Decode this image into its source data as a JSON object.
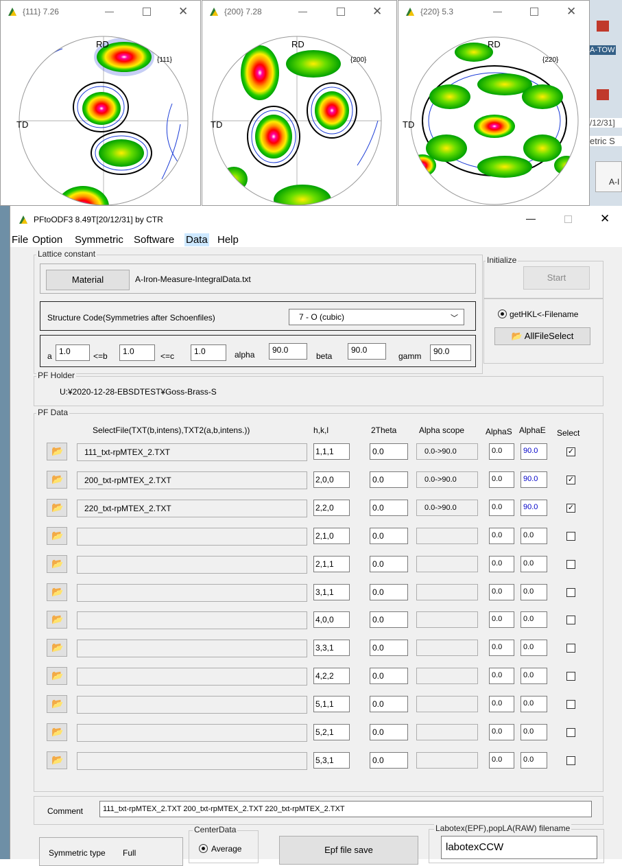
{
  "pf_windows": [
    {
      "title": "{111} 7.26",
      "label_top": "RD",
      "label_left": "TD",
      "plane": "{111}"
    },
    {
      "title": "{200} 7.28",
      "label_top": "RD",
      "label_left": "TD",
      "plane": "{200}"
    },
    {
      "title": "{220} 5.3",
      "label_top": "RD",
      "label_left": "TD",
      "plane": "{220}"
    }
  ],
  "window_controls": {
    "minimize": "—",
    "maximize": "☐",
    "close": "✕"
  },
  "background_fragments": [
    "A-TOW",
    "/12/31]",
    "etric S",
    "A-I"
  ],
  "main": {
    "title": "PFtoODF3 8.49T[20/12/31] by CTR",
    "menu": [
      "File",
      "Option",
      "Symmetric",
      "Software",
      "Data",
      "Help"
    ],
    "highlighted_menu": "Data",
    "lattice": {
      "group_label": "Lattice constant",
      "material_button": "Material",
      "material_file": "A-Iron-Measure-IntegralData.txt",
      "structure_label": "Structure Code(Symmetries after Schoenfiles)",
      "structure_value": "7 - O (cubic)",
      "params": [
        {
          "label": "a",
          "value": "1.0"
        },
        {
          "label": "<=b",
          "value": "1.0"
        },
        {
          "label": "<=c",
          "value": "1.0"
        },
        {
          "label": "alpha",
          "value": "90.0"
        },
        {
          "label": "beta",
          "value": "90.0"
        },
        {
          "label": "gamm",
          "value": "90.0"
        }
      ]
    },
    "initialize": {
      "group_label": "Initialize",
      "start_button": "Start"
    },
    "gethkl": {
      "radio_label": "getHKL<-Filename",
      "allfile_button": "AllFileSelect"
    },
    "pf_holder": {
      "group_label": "PF Holder",
      "path": "U:¥2020-12-28-EBSDTEST¥Goss-Brass-S"
    },
    "pf_data": {
      "group_label": "PF Data",
      "headers": {
        "file": "SelectFile(TXT(b,intens),TXT2(a,b,intens.))",
        "hkl": "h,k,l",
        "theta": "2Theta",
        "alpha_scope": "Alpha scope",
        "alphas": "AlphaS",
        "alphae": "AlphaE",
        "select": "Select"
      },
      "rows": [
        {
          "file": "111_txt-rpMTEX_2.TXT",
          "hkl": "1,1,1",
          "theta": "0.0",
          "scope": "0.0->90.0",
          "alphas": "0.0",
          "alphae": "90.0",
          "selected": true
        },
        {
          "file": "200_txt-rpMTEX_2.TXT",
          "hkl": "2,0,0",
          "theta": "0.0",
          "scope": "0.0->90.0",
          "alphas": "0.0",
          "alphae": "90.0",
          "selected": true
        },
        {
          "file": "220_txt-rpMTEX_2.TXT",
          "hkl": "2,2,0",
          "theta": "0.0",
          "scope": "0.0->90.0",
          "alphas": "0.0",
          "alphae": "90.0",
          "selected": true
        },
        {
          "file": "",
          "hkl": "2,1,0",
          "theta": "0.0",
          "scope": "",
          "alphas": "0.0",
          "alphae": "0.0",
          "selected": false
        },
        {
          "file": "",
          "hkl": "2,1,1",
          "theta": "0.0",
          "scope": "",
          "alphas": "0.0",
          "alphae": "0.0",
          "selected": false
        },
        {
          "file": "",
          "hkl": "3,1,1",
          "theta": "0.0",
          "scope": "",
          "alphas": "0.0",
          "alphae": "0.0",
          "selected": false
        },
        {
          "file": "",
          "hkl": "4,0,0",
          "theta": "0.0",
          "scope": "",
          "alphas": "0.0",
          "alphae": "0.0",
          "selected": false
        },
        {
          "file": "",
          "hkl": "3,3,1",
          "theta": "0.0",
          "scope": "",
          "alphas": "0.0",
          "alphae": "0.0",
          "selected": false
        },
        {
          "file": "",
          "hkl": "4,2,2",
          "theta": "0.0",
          "scope": "",
          "alphas": "0.0",
          "alphae": "0.0",
          "selected": false
        },
        {
          "file": "",
          "hkl": "5,1,1",
          "theta": "0.0",
          "scope": "",
          "alphas": "0.0",
          "alphae": "0.0",
          "selected": false
        },
        {
          "file": "",
          "hkl": "5,2,1",
          "theta": "0.0",
          "scope": "",
          "alphas": "0.0",
          "alphae": "0.0",
          "selected": false
        },
        {
          "file": "",
          "hkl": "5,3,1",
          "theta": "0.0",
          "scope": "",
          "alphas": "0.0",
          "alphae": "0.0",
          "selected": false
        }
      ]
    },
    "comment": {
      "label": "Comment",
      "value": "111_txt-rpMTEX_2.TXT 200_txt-rpMTEX_2.TXT 220_txt-rpMTEX_2.TXT"
    },
    "symmetric_type": {
      "label": "Symmetric type",
      "value": "Full"
    },
    "center_data": {
      "group_label": "CenterData",
      "radio_label": "Average"
    },
    "epf_save_button": "Epf file save",
    "labotex": {
      "group_label": "Labotex(EPF),popLA(RAW) filename",
      "value": "labotexCCW"
    }
  }
}
